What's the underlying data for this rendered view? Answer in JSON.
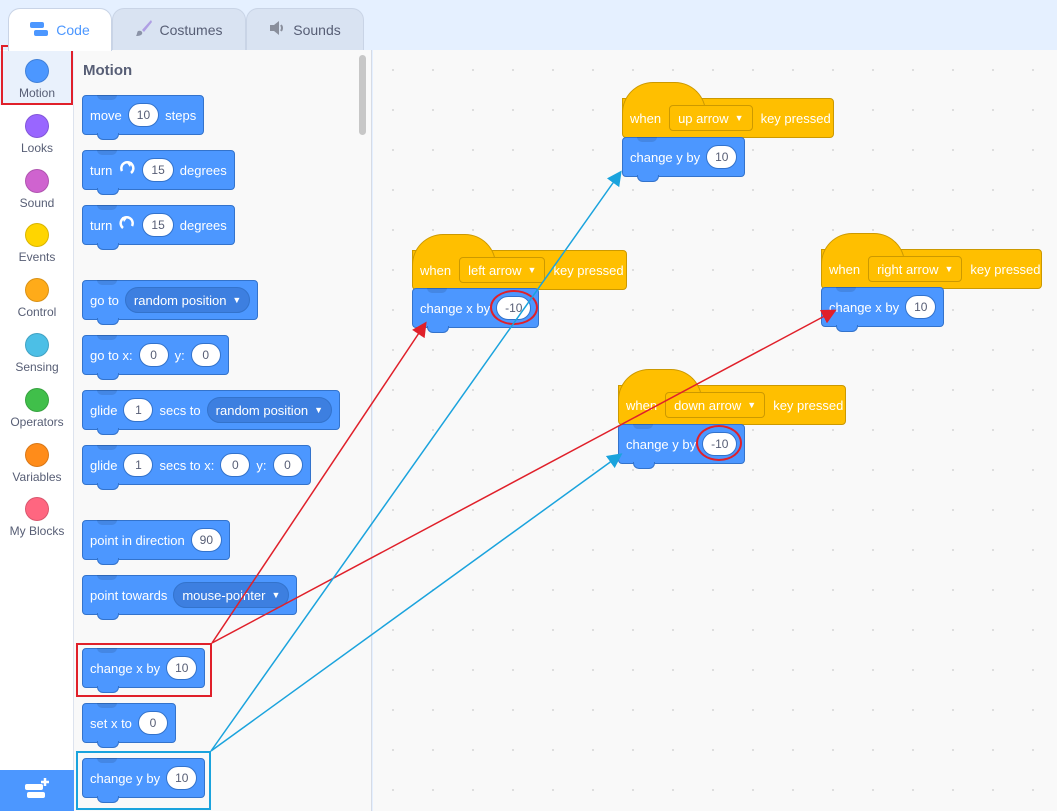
{
  "tabs": [
    {
      "label": "Code",
      "icon": "code-icon",
      "active": true
    },
    {
      "label": "Costumes",
      "icon": "brush-icon",
      "active": false
    },
    {
      "label": "Sounds",
      "icon": "speaker-icon",
      "active": false
    }
  ],
  "categories": [
    {
      "label": "Motion",
      "color": "#4c97ff"
    },
    {
      "label": "Looks",
      "color": "#9966ff"
    },
    {
      "label": "Sound",
      "color": "#cf63cf"
    },
    {
      "label": "Events",
      "color": "#ffd500"
    },
    {
      "label": "Control",
      "color": "#ffab19"
    },
    {
      "label": "Sensing",
      "color": "#4cbfe6"
    },
    {
      "label": "Operators",
      "color": "#40bf4a"
    },
    {
      "label": "Variables",
      "color": "#ff8c1a"
    },
    {
      "label": "My Blocks",
      "color": "#ff6680"
    }
  ],
  "palette": {
    "title": "Motion",
    "move": {
      "a": "move",
      "v": "10",
      "b": "steps"
    },
    "turn_right": {
      "a": "turn",
      "v": "15",
      "b": "degrees"
    },
    "turn_left": {
      "a": "turn",
      "v": "15",
      "b": "degrees"
    },
    "goto": {
      "a": "go to",
      "menu": "random position"
    },
    "goto_xy": {
      "a": "go to x:",
      "x": "0",
      "b": "y:",
      "y": "0"
    },
    "glide_to": {
      "a": "glide",
      "v": "1",
      "b": "secs to",
      "menu": "random position"
    },
    "glide_xy": {
      "a": "glide",
      "v": "1",
      "b": "secs to x:",
      "x": "0",
      "c": "y:",
      "y": "0"
    },
    "point_dir": {
      "a": "point in direction",
      "v": "90"
    },
    "point_towards": {
      "a": "point towards",
      "menu": "mouse-pointer"
    },
    "change_x": {
      "a": "change x by",
      "v": "10"
    },
    "set_x": {
      "a": "set x to",
      "v": "0"
    },
    "change_y": {
      "a": "change y by",
      "v": "10"
    }
  },
  "scripts": {
    "up": {
      "when": "when",
      "key": "up arrow",
      "pressed": "key pressed",
      "action": "change y by",
      "value": "10"
    },
    "left": {
      "when": "when",
      "key": "left arrow",
      "pressed": "key pressed",
      "action": "change x by",
      "value": "-10"
    },
    "right": {
      "when": "when",
      "key": "right arrow",
      "pressed": "key pressed",
      "action": "change x by",
      "value": "10"
    },
    "down": {
      "when": "when",
      "key": "down arrow",
      "pressed": "key pressed",
      "action": "change y by",
      "value": "-10"
    }
  },
  "annotation_colors": {
    "red": "#e0202a",
    "blue": "#1aa3dd"
  }
}
